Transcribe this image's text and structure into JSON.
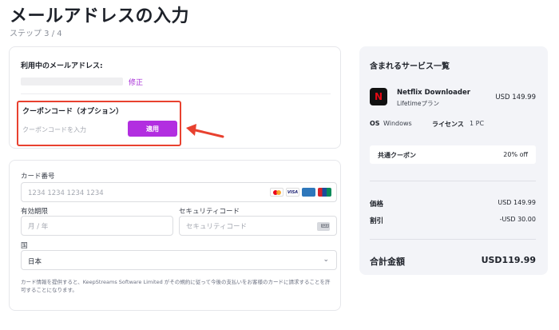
{
  "page": {
    "title": "メールアドレスの入力",
    "step": "ステップ 3 / 4"
  },
  "email_section": {
    "label": "利用中のメールアドレス:",
    "edit_link": "修正"
  },
  "coupon": {
    "title": "クーポンコード（オプション）",
    "placeholder": "クーポンコードを入力",
    "apply_label": "適用"
  },
  "payment": {
    "card_number_label": "カード番号",
    "card_number_placeholder": "1234 1234 1234 1234",
    "card_brand_icons": [
      "mastercard-icon",
      "visa-icon",
      "amex-icon",
      "unionpay-icon"
    ],
    "card_brand_visa_text": "VISA",
    "expiry_label": "有効期限",
    "expiry_placeholder": "月 / 年",
    "cvc_label": "セキュリティコード",
    "cvc_placeholder": "セキュリティコード",
    "country_label": "国",
    "country_value": "日本",
    "disclaimer": "カード情報を提供すると、KeepStreams Software Limited がその規約に従って今後の支払いをお客様のカードに請求することを許可することになります。"
  },
  "summary": {
    "title": "含まれるサービス一覧",
    "product": {
      "logo_text": "N",
      "name": "Netflix Downloader",
      "plan": "Lifetimeプラン",
      "price": "USD 149.99"
    },
    "os_label": "OS",
    "os_value": "Windows",
    "license_label": "ライセンス",
    "license_value": "1 PC",
    "coupon_label": "共通クーポン",
    "coupon_value": "20% off",
    "price_label": "価格",
    "price_value": "USD 149.99",
    "discount_label": "割引",
    "discount_value": "-USD 30.00",
    "total_label": "合計金額",
    "total_value": "USD119.99"
  },
  "colors": {
    "accent": "#b22ee0",
    "highlight": "#e8412f",
    "summary_bg": "#f3f4f8"
  }
}
